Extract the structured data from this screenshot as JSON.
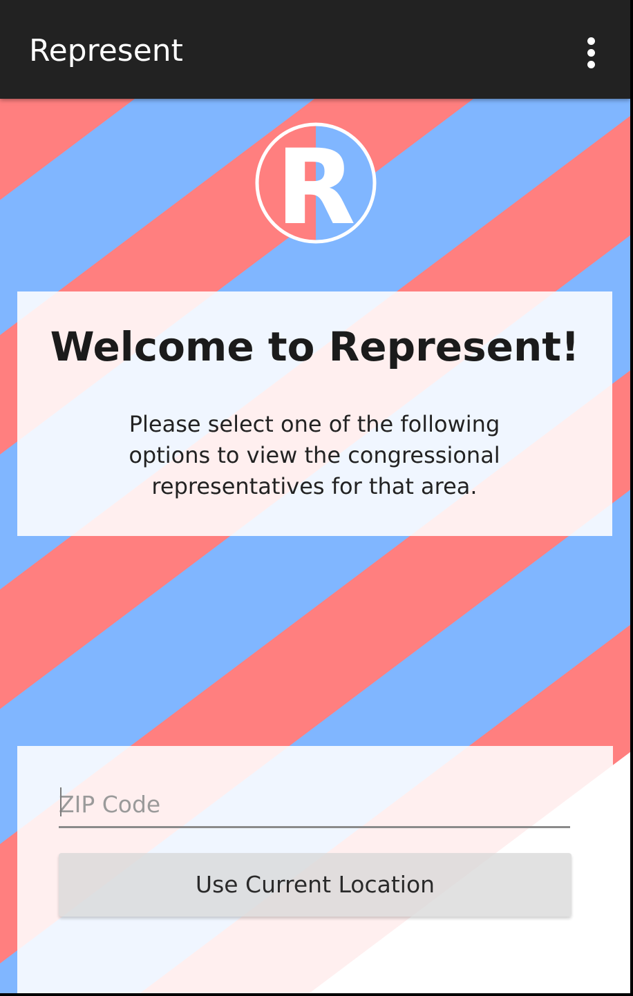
{
  "app_bar": {
    "title": "Represent",
    "overflow_icon": "more-vert-icon"
  },
  "logo": {
    "letter": "R",
    "left_color": "#ff7f7f",
    "right_color": "#80b6ff"
  },
  "welcome": {
    "title": "Welcome to Represent!",
    "subtitle": "Please select one of the following options to view the congressional representatives for that area."
  },
  "zip_field": {
    "placeholder": "ZIP Code",
    "value": ""
  },
  "location_button": {
    "label": "Use Current Location"
  },
  "colors": {
    "app_bar": "#222222",
    "stripe_red": "#ff7f7f",
    "stripe_blue": "#80b6ff",
    "background": "#ffffff"
  }
}
